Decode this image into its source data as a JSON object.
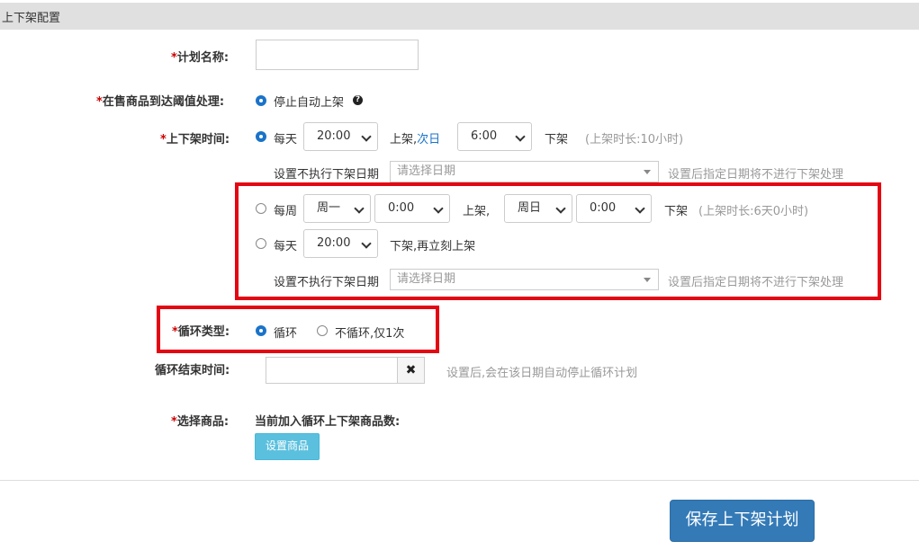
{
  "section": {
    "title": "上下架配置"
  },
  "form": {
    "required_mark": "*",
    "plan_name": {
      "label": "计划名称:",
      "value": ""
    },
    "threshold": {
      "label": "在售商品到达阈值处理:",
      "option": "停止自动上架",
      "help_icon": "?"
    },
    "shelf_time": {
      "label": "上下架时间:",
      "daily": {
        "prefix": "每天",
        "on_time": "20:00",
        "on_text": "上架,",
        "next_day": "次日",
        "off_time": "6:00",
        "off_text": "下架",
        "duration": "(上架时长:10小时)"
      },
      "exclude_label": "设置不执行下架日期",
      "exclude_placeholder": "请选择日期",
      "exclude_hint": "设置后指定日期将不进行下架处理",
      "weekly": {
        "prefix": "每周",
        "on_day": "周一",
        "on_time": "0:00",
        "on_text": "上架,",
        "off_day": "周日",
        "off_time": "0:00",
        "off_text": "下架",
        "duration": "(上架时长:6天0小时)"
      },
      "daily_relist": {
        "prefix": "每天",
        "time": "20:00",
        "text": "下架,再立刻上架"
      },
      "exclude2_label": "设置不执行下架日期",
      "exclude2_placeholder": "请选择日期",
      "exclude2_hint": "设置后指定日期将不进行下架处理"
    },
    "cycle_type": {
      "label": "循环类型:",
      "opt1": "循环",
      "opt2": "不循环,仅1次"
    },
    "cycle_end": {
      "label": "循环结束时间:",
      "value": "",
      "clear": "✖",
      "hint": "设置后,会在该日期自动停止循环计划"
    },
    "select_goods": {
      "label": "选择商品:",
      "count_text": "当前加入循环上下架商品数:",
      "button": "设置商品"
    },
    "save_button": "保存上下架计划"
  }
}
